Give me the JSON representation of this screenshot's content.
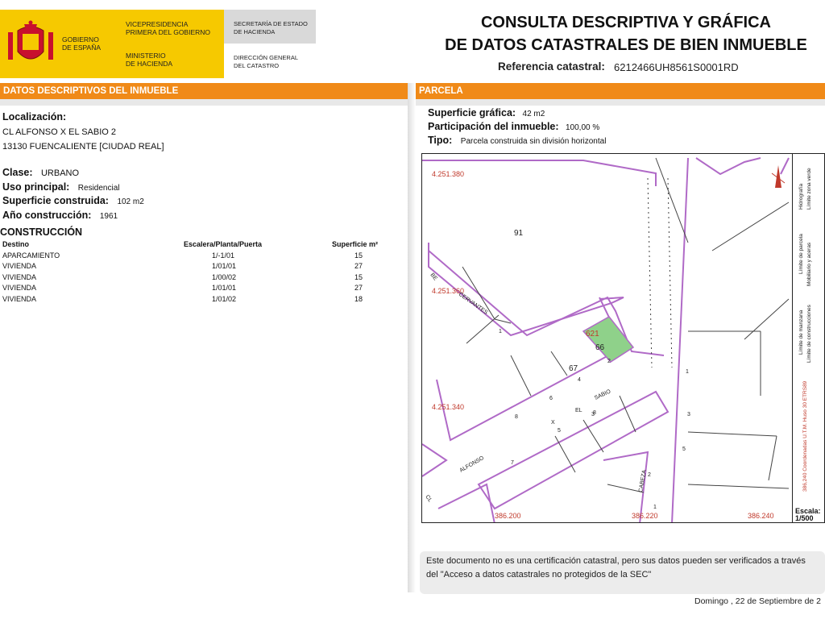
{
  "header": {
    "gobierno_line1": "GOBIERNO",
    "gobierno_line2": "DE ESPAÑA",
    "vicepresidencia_line1": "VICEPRESIDENCIA",
    "vicepresidencia_line2": "PRIMERA DEL GOBIERNO",
    "ministerio_line1": "MINISTERIO",
    "ministerio_line2": "DE HACIENDA",
    "secretaria_line1": "SECRETARÍA DE ESTADO",
    "secretaria_line2": "DE HACIENDA",
    "direccion_line1": "DIRECCIÓN GENERAL",
    "direccion_line2": "DEL CATASTRO",
    "title_line1": "CONSULTA DESCRIPTIVA Y GRÁFICA",
    "title_line2": "DE DATOS CATASTRALES DE BIEN INMUEBLE",
    "ref_label": "Referencia catastral:",
    "ref_value": "6212466UH8561S0001RD"
  },
  "left": {
    "section_title": "DATOS DESCRIPTIVOS DEL INMUEBLE",
    "localizacion_label": "Localización:",
    "address_line1": "CL ALFONSO X EL SABIO 2",
    "address_line2": "13130 FUENCALIENTE [CIUDAD REAL]",
    "clase_label": "Clase:",
    "clase_value": "URBANO",
    "uso_label": "Uso principal:",
    "uso_value": "Residencial",
    "superficie_label": "Superficie construida:",
    "superficie_value": "102 m2",
    "anio_label": "Año construcción:",
    "anio_value": "1961",
    "construccion_title": "CONSTRUCCIÓN",
    "table_headers": [
      "Destino",
      "Escalera/Planta/Puerta",
      "Superficie m²"
    ],
    "table_rows": [
      [
        "APARCAMIENTO",
        "1/-1/01",
        "15"
      ],
      [
        "VIVIENDA",
        "1/01/01",
        "27"
      ],
      [
        "VIVIENDA",
        "1/00/02",
        "15"
      ],
      [
        "VIVIENDA",
        "1/01/01",
        "27"
      ],
      [
        "VIVIENDA",
        "1/01/02",
        "18"
      ]
    ]
  },
  "right": {
    "section_title": "PARCELA",
    "sup_grafica_label": "Superficie gráfica:",
    "sup_grafica_value": "42 m2",
    "participacion_label": "Participación del inmueble:",
    "participacion_value": "100,00 %",
    "tipo_label": "Tipo:",
    "tipo_value": "Parcela construida sin división horizontal",
    "map": {
      "y_labels": [
        "4.251.380",
        "4.251.360",
        "4.251.340"
      ],
      "x_labels": [
        "386.200",
        "386.220",
        "386.240"
      ],
      "block_numbers": [
        "91",
        "67",
        "66",
        "621"
      ],
      "street_labels": [
        "CERVANTES",
        "ALFONSO",
        "X",
        "EL",
        "SABIO",
        "CABEZA",
        "CL",
        "BE"
      ],
      "house_numbers": [
        "1",
        "2",
        "4",
        "6",
        "8",
        "3",
        "5",
        "7",
        "8",
        "1",
        "3",
        "5",
        "2",
        "1"
      ],
      "highlight_color": "#8fd18a",
      "parcel_line_color": "#b06ac7"
    },
    "legend_items": [
      "Hidrografía",
      "Límite zona verde",
      "Límite de parcela",
      "Mobiliario y aceras",
      "Límite de manzana",
      "Límite de construcciones",
      "386,240 Coordenadas U.T.M. Huso 30 ETRS89"
    ],
    "scale_label": "Escala:",
    "scale_value": "1/500",
    "note": "Este documento no es una certificación catastral, pero sus datos pueden ser verificados a través del \"Acceso a datos catastrales no protegidos de la SEC\"",
    "footer_date": "Domingo , 22 de Septiembre de 2"
  },
  "colors": {
    "orange": "#f08a18",
    "yellow": "#f6c900",
    "grey": "#d9d9d9"
  }
}
